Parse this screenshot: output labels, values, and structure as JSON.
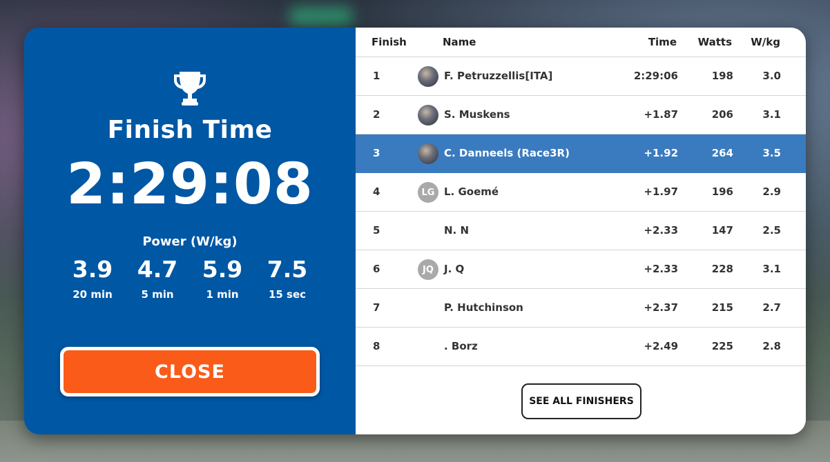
{
  "finish": {
    "title": "Finish Time",
    "time": "2:29:08",
    "power_label": "Power (W/kg)",
    "power_stats": [
      {
        "value": "3.9",
        "label": "20 min"
      },
      {
        "value": "4.7",
        "label": "5 min"
      },
      {
        "value": "5.9",
        "label": "1 min"
      },
      {
        "value": "7.5",
        "label": "15 sec"
      }
    ],
    "close_label": "CLOSE",
    "close_color": "#fa5b19",
    "panel_color": "#0057a4",
    "trophy_icon": "trophy-icon"
  },
  "results": {
    "headers": {
      "finish": "Finish",
      "name": "Name",
      "time": "Time",
      "watts": "Watts",
      "wkg": "W/kg"
    },
    "highlight_color": "#3a7bbf",
    "rows": [
      {
        "pos": "1",
        "name": "F. Petruzzellis[ITA]",
        "time": "2:29:06",
        "watts": "198",
        "wkg": "3.0",
        "avatar": "photo",
        "initials": ""
      },
      {
        "pos": "2",
        "name": "S. Muskens",
        "time": "+1.87",
        "watts": "206",
        "wkg": "3.1",
        "avatar": "photo",
        "initials": ""
      },
      {
        "pos": "3",
        "name": "C. Danneels (Race3R)",
        "time": "+1.92",
        "watts": "264",
        "wkg": "3.5",
        "avatar": "photo",
        "initials": "",
        "highlight": true
      },
      {
        "pos": "4",
        "name": "L. Goemé",
        "time": "+1.97",
        "watts": "196",
        "wkg": "2.9",
        "avatar": "initials",
        "initials": "LG"
      },
      {
        "pos": "5",
        "name": "N. N",
        "time": "+2.33",
        "watts": "147",
        "wkg": "2.5",
        "avatar": "none",
        "initials": ""
      },
      {
        "pos": "6",
        "name": "J. Q",
        "time": "+2.33",
        "watts": "228",
        "wkg": "3.1",
        "avatar": "initials",
        "initials": "JQ"
      },
      {
        "pos": "7",
        "name": "P. Hutchinson",
        "time": "+2.37",
        "watts": "215",
        "wkg": "2.7",
        "avatar": "none",
        "initials": ""
      },
      {
        "pos": "8",
        "name": ". Borz",
        "time": "+2.49",
        "watts": "225",
        "wkg": "2.8",
        "avatar": "none",
        "initials": ""
      }
    ],
    "see_all_label": "SEE ALL FINISHERS"
  }
}
